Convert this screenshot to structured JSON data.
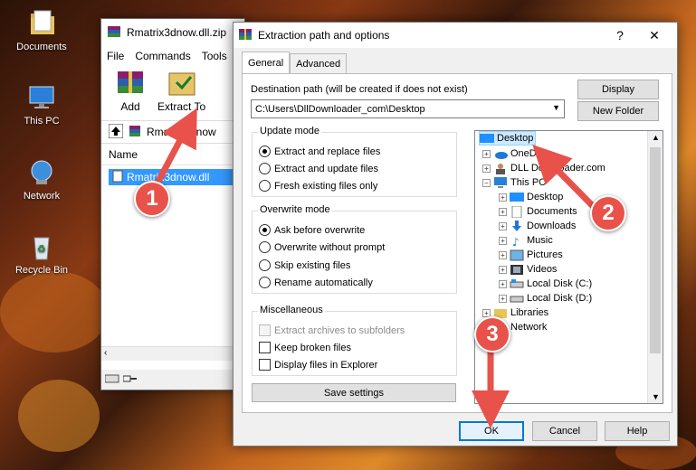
{
  "desktop": {
    "icons": [
      {
        "label": "Documents"
      },
      {
        "label": "This PC"
      },
      {
        "label": "Network"
      },
      {
        "label": "Recycle Bin"
      }
    ]
  },
  "winrar": {
    "title": "Rmatrix3dnow.dll.zip",
    "menu": [
      "File",
      "Commands",
      "Tools"
    ],
    "tools": [
      {
        "label": "Add"
      },
      {
        "label": "Extract To"
      }
    ],
    "address": "Rmatrix3dnow",
    "column_name": "Name",
    "file": "Rmatrix3dnow.dll"
  },
  "dialog": {
    "title": "Extraction path and options",
    "help_btn": "?",
    "close_btn": "✕",
    "tabs": [
      "General",
      "Advanced"
    ],
    "dest_label": "Destination path (will be created if does not exist)",
    "dest_value": "C:\\Users\\DllDownloader_com\\Desktop",
    "display_btn": "Display",
    "new_folder_btn": "New Folder",
    "update_mode": {
      "title": "Update mode",
      "options": [
        "Extract and replace files",
        "Extract and update files",
        "Fresh existing files only"
      ],
      "selected": 0
    },
    "overwrite_mode": {
      "title": "Overwrite mode",
      "options": [
        "Ask before overwrite",
        "Overwrite without prompt",
        "Skip existing files",
        "Rename automatically"
      ],
      "selected": 0
    },
    "misc": {
      "title": "Miscellaneous",
      "options": [
        "Extract archives to subfolders",
        "Keep broken files",
        "Display files in Explorer"
      ]
    },
    "save_settings": "Save settings",
    "tree": [
      {
        "label": "Desktop",
        "selected": true
      },
      {
        "label": "OneDrive"
      },
      {
        "label": "DLL Downloader.com"
      },
      {
        "label": "This PC"
      },
      {
        "label": "Desktop"
      },
      {
        "label": "Documents"
      },
      {
        "label": "Downloads"
      },
      {
        "label": "Music"
      },
      {
        "label": "Pictures"
      },
      {
        "label": "Videos"
      },
      {
        "label": "Local Disk (C:)"
      },
      {
        "label": "Local Disk (D:)"
      },
      {
        "label": "Libraries"
      },
      {
        "label": "Network"
      }
    ],
    "ok": "OK",
    "cancel": "Cancel",
    "help": "Help"
  },
  "steps": [
    "1",
    "2",
    "3"
  ],
  "colors": {
    "accent": "#3399ff",
    "badge": "#e8524a"
  }
}
